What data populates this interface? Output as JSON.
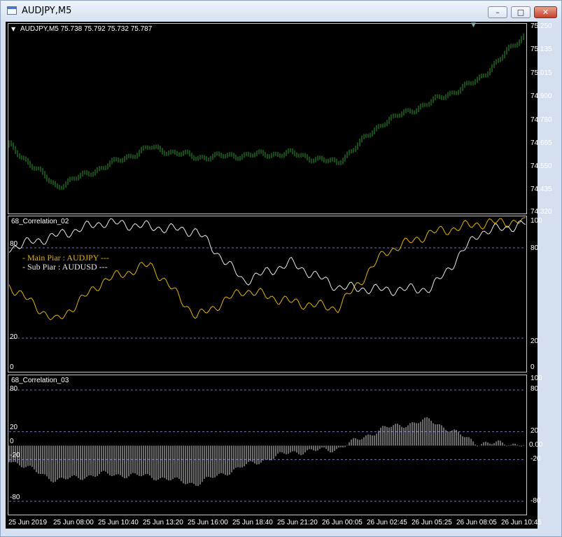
{
  "window": {
    "title": "AUDJPY,M5",
    "minimize_glyph": "–",
    "maximize_glyph": "□",
    "close_glyph": "✕"
  },
  "main": {
    "header": "AUDJPY,M5  75.738 75.792 75.732 75.787",
    "yticks": [
      "75.250",
      "75.135",
      "75.015",
      "74.900",
      "74.780",
      "74.665",
      "74.550",
      "74.435",
      "74.320"
    ],
    "color": "#2e9a2e"
  },
  "ind1": {
    "name": "68_Correlation_02",
    "legend_main": "- Main Piar : AUDJPY ---",
    "legend_sub": "- Sub Piar  : AUDUSD ---",
    "main_color": "#e6b400",
    "sub_color": "#e8e8e8",
    "left_levels": [
      "80",
      "20",
      "0"
    ],
    "right_levels": [
      "100",
      "80",
      "20",
      "0"
    ]
  },
  "ind2": {
    "name": "68_Correlation_03",
    "left_levels": [
      "80",
      "20",
      "0",
      "-20",
      "-80"
    ],
    "right_levels": [
      "100",
      "80",
      "20",
      "0.00",
      "-20",
      "-80"
    ]
  },
  "xaxis": [
    "25 Jun 2019",
    "25 Jun 08:00",
    "25 Jun 10:40",
    "25 Jun 13:20",
    "25 Jun 16:00",
    "25 Jun 18:40",
    "25 Jun 21:20",
    "26 Jun 00:05",
    "26 Jun 02:45",
    "26 Jun 05:25",
    "26 Jun 08:05",
    "26 Jun 10:45"
  ],
  "chart_data": [
    {
      "type": "line",
      "title": "AUDJPY,M5",
      "x": [
        "25 Jun 2019",
        "25 Jun 08:00",
        "25 Jun 10:40",
        "25 Jun 13:20",
        "25 Jun 16:00",
        "25 Jun 18:40",
        "25 Jun 21:20",
        "26 Jun 00:05",
        "26 Jun 02:45",
        "26 Jun 05:25",
        "26 Jun 08:05",
        "26 Jun 10:45"
      ],
      "series": [
        {
          "values": [
            74.64,
            74.43,
            74.53,
            74.63,
            74.58,
            74.59,
            74.6,
            74.55,
            74.76,
            74.86,
            74.97,
            75.2
          ]
        }
      ],
      "ylim": [
        74.3,
        75.25
      ]
    },
    {
      "type": "line",
      "title": "68_Correlation_02",
      "x": [
        "25 Jun 2019",
        "25 Jun 08:00",
        "25 Jun 10:40",
        "25 Jun 13:20",
        "25 Jun 16:00",
        "25 Jun 18:40",
        "25 Jun 21:20",
        "26 Jun 00:05",
        "26 Jun 02:45",
        "26 Jun 05:25",
        "26 Jun 08:05",
        "26 Jun 10:45"
      ],
      "series": [
        {
          "name": "AUDJPY",
          "values": [
            55,
            31,
            58,
            69,
            34,
            52,
            44,
            40,
            77,
            90,
            96,
            98
          ]
        },
        {
          "name": "AUDUSD",
          "values": [
            80,
            88,
            97,
            94,
            91,
            58,
            70,
            54,
            52,
            53,
            90,
            96
          ]
        }
      ],
      "ylim": [
        0,
        100
      ]
    },
    {
      "type": "bar",
      "title": "68_Correlation_03",
      "x": [
        "25 Jun 2019",
        "25 Jun 08:00",
        "25 Jun 10:40",
        "25 Jun 13:20",
        "25 Jun 16:00",
        "25 Jun 18:40",
        "25 Jun 21:20",
        "26 Jun 00:05",
        "26 Jun 02:45",
        "26 Jun 05:25",
        "26 Jun 08:05",
        "26 Jun 10:45"
      ],
      "values": [
        -20,
        -50,
        -41,
        -44,
        -55,
        -30,
        -10,
        -5,
        25,
        37,
        4,
        2
      ],
      "ylim": [
        -100,
        100
      ]
    }
  ]
}
